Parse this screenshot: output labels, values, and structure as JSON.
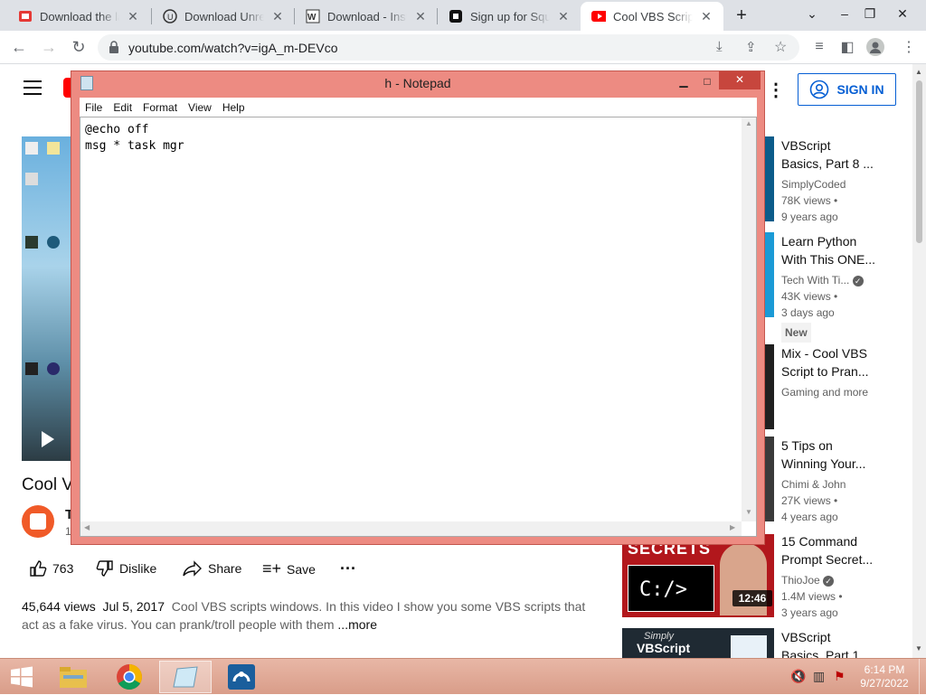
{
  "browser": {
    "tabs": [
      {
        "title": "Download the lat",
        "icon": "red-app-icon"
      },
      {
        "title": "Download Unreal",
        "icon": "unreal-icon"
      },
      {
        "title": "Download - Insta",
        "icon": "w-icon"
      },
      {
        "title": "Sign up for Squar",
        "icon": "square-icon"
      },
      {
        "title": "Cool VBS Script t",
        "icon": "youtube-icon"
      }
    ],
    "url": "youtube.com/watch?v=igA_m-DEVco"
  },
  "youtube": {
    "signin_label": "SIGN IN",
    "video_title_partial": "Cool V",
    "channel_initial": "T",
    "subs_partial": "1",
    "likes": "763",
    "dislike_label": "Dislike",
    "share_label": "Share",
    "save_label": "Save",
    "views": "45,644 views",
    "date": "Jul 5, 2017",
    "description": "Cool VBS scripts windows. In this video I show you some VBS scripts that act as a fake virus. You can prank/troll people with them",
    "more_label": "...more",
    "related": [
      {
        "title1": "VBScript",
        "title2": "Basics, Part 8 ...",
        "channel": "SimplyCoded",
        "views": "78K views •",
        "age": "9 years ago"
      },
      {
        "title1": "Learn Python",
        "title2": "With This ONE...",
        "channel": "Tech With Ti...",
        "views": "43K views •",
        "age": "3 days ago",
        "badge": "New"
      },
      {
        "title1": "Mix - Cool VBS",
        "title2": "Script to Pran...",
        "channel": "Gaming and more"
      },
      {
        "title1": "5 Tips on",
        "title2": "Winning Your...",
        "channel": "Chimi & John",
        "views": "27K views •",
        "age": "4 years ago"
      },
      {
        "title1": "15 Command",
        "title2": "Prompt Secret...",
        "channel": "ThioJoe",
        "views": "1.4M views •",
        "age": "3 years ago",
        "duration": "12:46",
        "thumb_text": "SECRETS",
        "thumb_prompt": "C:/>"
      },
      {
        "title1": "VBScript",
        "title2": "Basics, Part 1 ...",
        "thumb_text1": "Simply",
        "thumb_text2": "VBScript"
      }
    ]
  },
  "notepad": {
    "title": "h - Notepad",
    "menu": [
      "File",
      "Edit",
      "Format",
      "View",
      "Help"
    ],
    "content_line1": "@echo off",
    "content_line2": "msg * task mgr"
  },
  "taskbar": {
    "time": "6:14 PM",
    "date": "9/27/2022"
  }
}
